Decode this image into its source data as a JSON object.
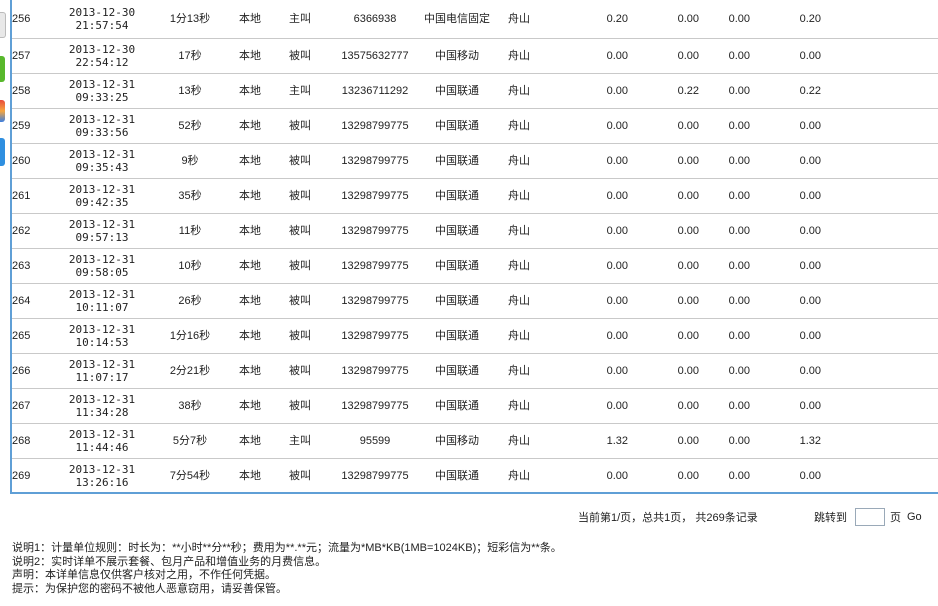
{
  "rows": [
    {
      "idx": "256",
      "date": "2013-12-30",
      "time": "21:57:54",
      "duration": "1分13秒",
      "location": "本地",
      "call_type": "主叫",
      "number": "6366938",
      "carrier": "中国电信固定",
      "city": "舟山",
      "fee1": "0.20",
      "fee2": "0.00",
      "fee3": "0.00",
      "total": "0.20"
    },
    {
      "idx": "257",
      "date": "2013-12-30",
      "time": "22:54:12",
      "duration": "17秒",
      "location": "本地",
      "call_type": "被叫",
      "number": "13575632777",
      "carrier": "中国移动",
      "city": "舟山",
      "fee1": "0.00",
      "fee2": "0.00",
      "fee3": "0.00",
      "total": "0.00"
    },
    {
      "idx": "258",
      "date": "2013-12-31",
      "time": "09:33:25",
      "duration": "13秒",
      "location": "本地",
      "call_type": "主叫",
      "number": "13236711292",
      "carrier": "中国联通",
      "city": "舟山",
      "fee1": "0.00",
      "fee2": "0.22",
      "fee3": "0.00",
      "total": "0.22"
    },
    {
      "idx": "259",
      "date": "2013-12-31",
      "time": "09:33:56",
      "duration": "52秒",
      "location": "本地",
      "call_type": "被叫",
      "number": "13298799775",
      "carrier": "中国联通",
      "city": "舟山",
      "fee1": "0.00",
      "fee2": "0.00",
      "fee3": "0.00",
      "total": "0.00"
    },
    {
      "idx": "260",
      "date": "2013-12-31",
      "time": "09:35:43",
      "duration": "9秒",
      "location": "本地",
      "call_type": "被叫",
      "number": "13298799775",
      "carrier": "中国联通",
      "city": "舟山",
      "fee1": "0.00",
      "fee2": "0.00",
      "fee3": "0.00",
      "total": "0.00"
    },
    {
      "idx": "261",
      "date": "2013-12-31",
      "time": "09:42:35",
      "duration": "35秒",
      "location": "本地",
      "call_type": "被叫",
      "number": "13298799775",
      "carrier": "中国联通",
      "city": "舟山",
      "fee1": "0.00",
      "fee2": "0.00",
      "fee3": "0.00",
      "total": "0.00"
    },
    {
      "idx": "262",
      "date": "2013-12-31",
      "time": "09:57:13",
      "duration": "11秒",
      "location": "本地",
      "call_type": "被叫",
      "number": "13298799775",
      "carrier": "中国联通",
      "city": "舟山",
      "fee1": "0.00",
      "fee2": "0.00",
      "fee3": "0.00",
      "total": "0.00"
    },
    {
      "idx": "263",
      "date": "2013-12-31",
      "time": "09:58:05",
      "duration": "10秒",
      "location": "本地",
      "call_type": "被叫",
      "number": "13298799775",
      "carrier": "中国联通",
      "city": "舟山",
      "fee1": "0.00",
      "fee2": "0.00",
      "fee3": "0.00",
      "total": "0.00"
    },
    {
      "idx": "264",
      "date": "2013-12-31",
      "time": "10:11:07",
      "duration": "26秒",
      "location": "本地",
      "call_type": "被叫",
      "number": "13298799775",
      "carrier": "中国联通",
      "city": "舟山",
      "fee1": "0.00",
      "fee2": "0.00",
      "fee3": "0.00",
      "total": "0.00"
    },
    {
      "idx": "265",
      "date": "2013-12-31",
      "time": "10:14:53",
      "duration": "1分16秒",
      "location": "本地",
      "call_type": "被叫",
      "number": "13298799775",
      "carrier": "中国联通",
      "city": "舟山",
      "fee1": "0.00",
      "fee2": "0.00",
      "fee3": "0.00",
      "total": "0.00"
    },
    {
      "idx": "266",
      "date": "2013-12-31",
      "time": "11:07:17",
      "duration": "2分21秒",
      "location": "本地",
      "call_type": "被叫",
      "number": "13298799775",
      "carrier": "中国联通",
      "city": "舟山",
      "fee1": "0.00",
      "fee2": "0.00",
      "fee3": "0.00",
      "total": "0.00"
    },
    {
      "idx": "267",
      "date": "2013-12-31",
      "time": "11:34:28",
      "duration": "38秒",
      "location": "本地",
      "call_type": "被叫",
      "number": "13298799775",
      "carrier": "中国联通",
      "city": "舟山",
      "fee1": "0.00",
      "fee2": "0.00",
      "fee3": "0.00",
      "total": "0.00"
    },
    {
      "idx": "268",
      "date": "2013-12-31",
      "time": "11:44:46",
      "duration": "5分7秒",
      "location": "本地",
      "call_type": "主叫",
      "number": "95599",
      "carrier": "中国移动",
      "city": "舟山",
      "fee1": "1.32",
      "fee2": "0.00",
      "fee3": "0.00",
      "total": "1.32"
    },
    {
      "idx": "269",
      "date": "2013-12-31",
      "time": "13:26:16",
      "duration": "7分54秒",
      "location": "本地",
      "call_type": "被叫",
      "number": "13298799775",
      "carrier": "中国联通",
      "city": "舟山",
      "fee1": "0.00",
      "fee2": "0.00",
      "fee3": "0.00",
      "total": "0.00"
    }
  ],
  "pager": {
    "status": "当前第1/页，总共1页， 共269条记录",
    "jump_label": "跳转到",
    "page_value": "",
    "page_unit": "页",
    "go_label": "Go"
  },
  "notes": [
    "说明1：计量单位规则：时长为：**小时**分**秒；费用为**.**元；流量为*MB*KB(1MB=1024KB)；短彩信为**条。",
    "说明2：实时详单不展示套餐、包月产品和增值业务的月费信息。",
    "声明：本详单信息仅供客户核对之用，不作任何凭据。",
    "提示：为保护您的密码不被他人恶意窃用，请妥善保管。"
  ],
  "colors": {
    "panel_border": "#5f9fd6",
    "row_border": "#c9c9c9"
  }
}
